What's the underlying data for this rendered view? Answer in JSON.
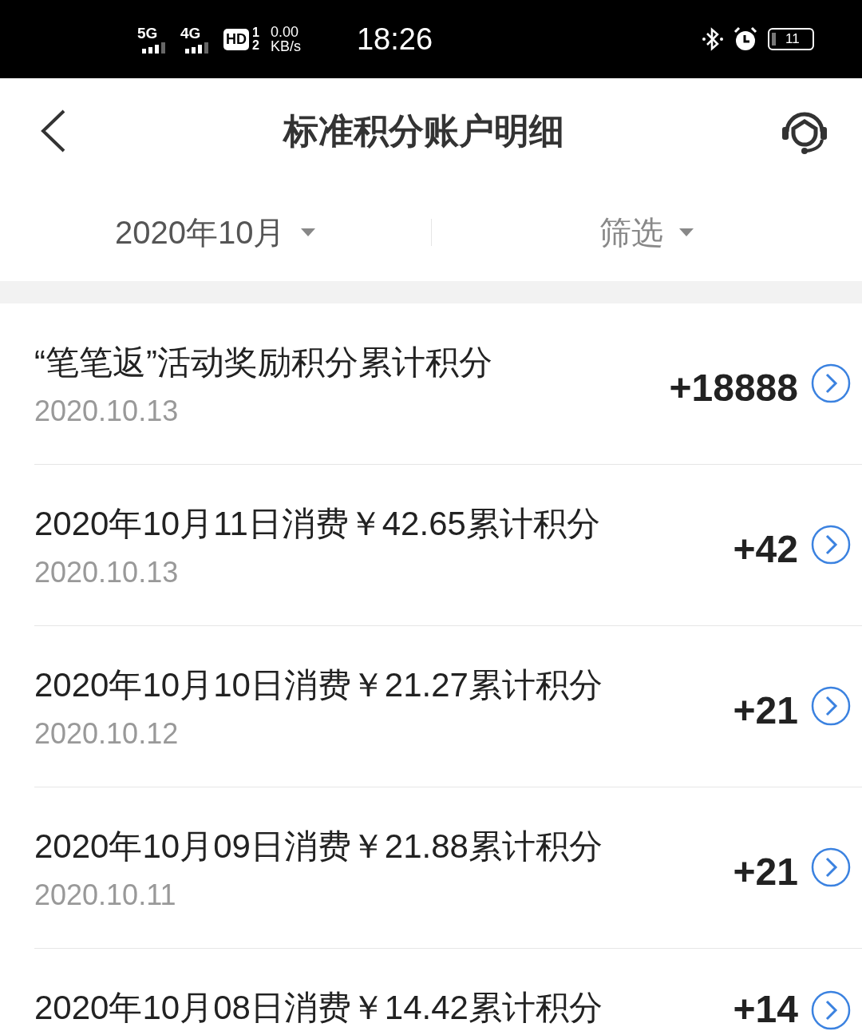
{
  "status_bar": {
    "network_1": "5G",
    "network_2": "4G",
    "hd": "HD",
    "sim_1": "1",
    "sim_2": "2",
    "speed": "0.00",
    "speed_unit": "KB/s",
    "time": "18:26",
    "battery": "11"
  },
  "header": {
    "title": "标准积分账户明细"
  },
  "filters": {
    "month": "2020年10月",
    "filter": "筛选"
  },
  "records": [
    {
      "title": "“笔笔返”活动奖励积分累计积分",
      "date": "2020.10.13",
      "amount": "+18888"
    },
    {
      "title": "2020年10月11日消费￥42.65累计积分",
      "date": "2020.10.13",
      "amount": "+42"
    },
    {
      "title": "2020年10月10日消费￥21.27累计积分",
      "date": "2020.10.12",
      "amount": "+21"
    },
    {
      "title": "2020年10月09日消费￥21.88累计积分",
      "date": "2020.10.11",
      "amount": "+21"
    },
    {
      "title": "2020年10月08日消费￥14.42累计积分",
      "amount": "+14"
    }
  ]
}
